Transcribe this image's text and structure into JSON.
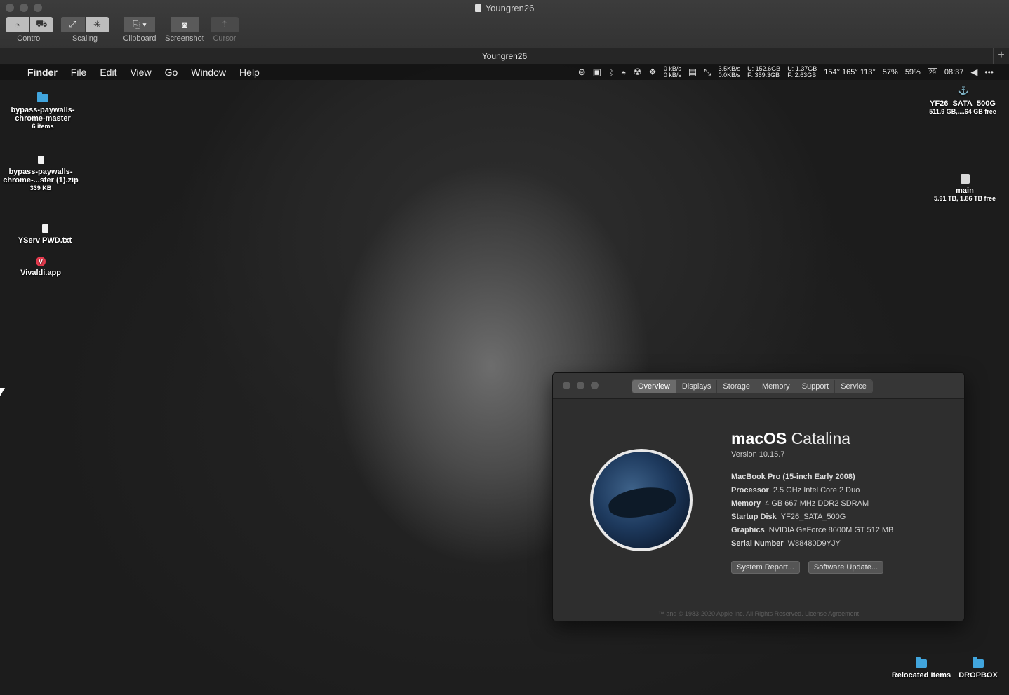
{
  "window": {
    "title": "Youngren26",
    "tab_title": "Youngren26",
    "add_tab": "+"
  },
  "toolbar": {
    "control_label": "Control",
    "scaling_label": "Scaling",
    "clipboard_label": "Clipboard",
    "screenshot_label": "Screenshot",
    "cursor_label": "Cursor"
  },
  "menubar": {
    "apple": "",
    "app": "Finder",
    "items": [
      "File",
      "Edit",
      "View",
      "Go",
      "Window",
      "Help"
    ],
    "net_up": "0 kB/s",
    "net_down": "0 kB/s",
    "disk_read": "3.5KB/s",
    "disk_write": "0.0KB/s",
    "storage1_u": "U: 152.6GB",
    "storage1_f": "F: 359.3GB",
    "storage2_u": "U: 1.37GB",
    "storage2_f": "F: 2.63GB",
    "temps": "154° 165° 113°",
    "cpu": "57%",
    "battery": "59%",
    "date_day": "29",
    "clock": "08:37",
    "more": "•••"
  },
  "desktop": {
    "icons_left": [
      {
        "name": "bypass-paywalls-chrome-master",
        "sub": "6 items"
      },
      {
        "name": "bypass-paywalls-chrome-...ster (1).zip",
        "sub": "339 KB"
      },
      {
        "name": "YServ PWD.txt",
        "sub": ""
      },
      {
        "name": "Vivaldi.app",
        "sub": ""
      }
    ],
    "icons_right": [
      {
        "name": "YF26_SATA_500G",
        "sub": "511.9 GB,....64 GB free"
      },
      {
        "name": "main",
        "sub": "5.91 TB, 1.86 TB free"
      }
    ],
    "icons_bottom": [
      {
        "name": "Relocated Items"
      },
      {
        "name": "DROPBOX"
      }
    ]
  },
  "about": {
    "tabs": [
      "Overview",
      "Displays",
      "Storage",
      "Memory",
      "Support",
      "Service"
    ],
    "os_name": "macOS",
    "os_release": "Catalina",
    "version": "Version 10.15.7",
    "model": "MacBook Pro (15-inch Early 2008)",
    "processor_label": "Processor",
    "processor": "2.5 GHz Intel Core 2 Duo",
    "memory_label": "Memory",
    "memory": "4 GB 667 MHz DDR2 SDRAM",
    "startup_label": "Startup Disk",
    "startup": "YF26_SATA_500G",
    "graphics_label": "Graphics",
    "graphics": "NVIDIA GeForce 8600M GT 512 MB",
    "serial_label": "Serial Number",
    "serial": "W88480D9YJY",
    "system_report": "System Report...",
    "software_update": "Software Update...",
    "footer": "™ and © 1983-2020 Apple Inc. All Rights Reserved. License Agreement"
  }
}
